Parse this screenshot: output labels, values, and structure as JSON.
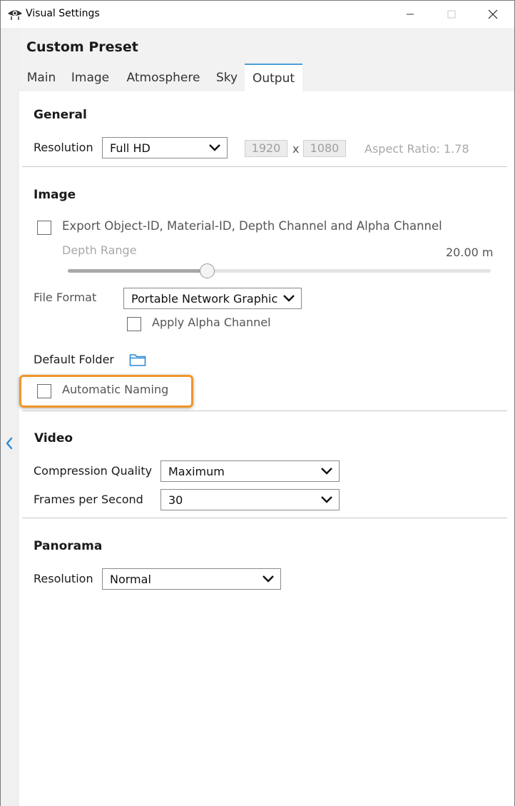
{
  "window": {
    "title": "Visual Settings",
    "icon": "eye-icon",
    "controls": [
      "minimize-icon",
      "maximize-icon",
      "close-icon"
    ]
  },
  "panel": {
    "preset_title": "Custom Preset",
    "tabs": [
      {
        "label": "Main",
        "active": false
      },
      {
        "label": "Image",
        "active": false
      },
      {
        "label": "Atmosphere",
        "active": false
      },
      {
        "label": "Sky",
        "active": false
      },
      {
        "label": "Output",
        "active": true
      }
    ]
  },
  "general": {
    "title": "General",
    "resolution_label": "Resolution",
    "resolution_value": "Full HD",
    "width": "1920",
    "times": "x",
    "height": "1080",
    "aspect_ratio": "Aspect Ratio: 1.78"
  },
  "image": {
    "title": "Image",
    "export_label": "Export Object-ID, Material-ID, Depth Channel and Alpha Channel",
    "export_checked": false,
    "depth_range_label": "Depth Range",
    "depth_range_value": "20.00 m",
    "depth_range_fraction": 0.33,
    "file_format_label": "File Format",
    "file_format_value": "Portable Network Graphic",
    "alpha_label": "Apply Alpha Channel",
    "alpha_checked": false,
    "default_folder_label": "Default Folder",
    "folder_icon": "folder-icon",
    "auto_naming_label": "Automatic Naming",
    "auto_naming_checked": false
  },
  "video": {
    "title": "Video",
    "quality_label": "Compression Quality",
    "quality_value": "Maximum",
    "fps_label": "Frames per Second",
    "fps_value": "30"
  },
  "panorama": {
    "title": "Panorama",
    "resolution_label": "Resolution",
    "resolution_value": "Normal"
  },
  "colors": {
    "accent": "#4aa0d8",
    "highlight": "#f0962a"
  }
}
